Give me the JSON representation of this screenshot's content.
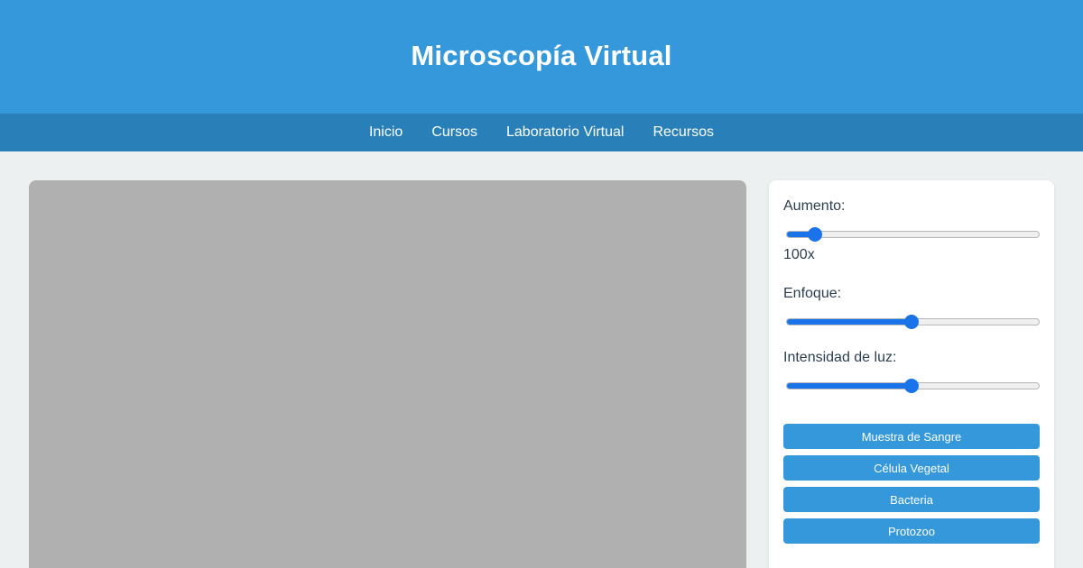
{
  "header": {
    "title": "Microscopía Virtual"
  },
  "nav": {
    "items": [
      {
        "label": "Inicio"
      },
      {
        "label": "Cursos"
      },
      {
        "label": "Laboratorio Virtual"
      },
      {
        "label": "Recursos"
      }
    ]
  },
  "viewer": {
    "background_color": "#b0b0b0"
  },
  "controls": {
    "magnification": {
      "label": "Aumento:",
      "value_text": "100x",
      "slider_fraction": 0.09
    },
    "focus": {
      "label": "Enfoque:",
      "slider_fraction": 0.5
    },
    "light": {
      "label": "Intensidad de luz:",
      "slider_fraction": 0.5
    }
  },
  "samples": [
    {
      "label": "Muestra de Sangre"
    },
    {
      "label": "Célula Vegetal"
    },
    {
      "label": "Bacteria"
    },
    {
      "label": "Protozoo"
    }
  ],
  "colors": {
    "header": "#3498db",
    "nav": "#2980b9",
    "accent": "#1a73e8",
    "background": "#ecf0f1"
  }
}
